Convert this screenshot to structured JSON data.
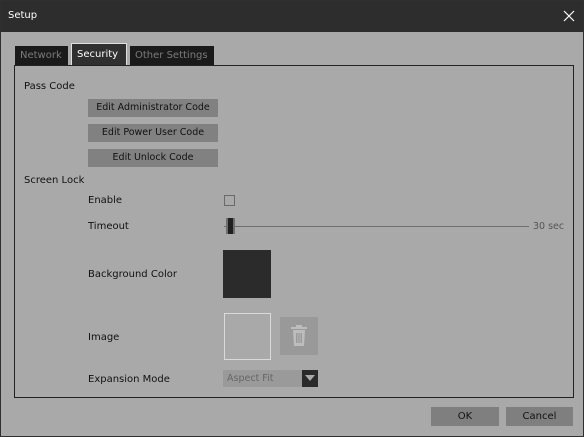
{
  "window": {
    "title": "Setup"
  },
  "tabs": [
    {
      "label": "Network",
      "active": false
    },
    {
      "label": "Security",
      "active": true
    },
    {
      "label": "Other Settings",
      "active": false
    }
  ],
  "pass_code": {
    "heading": "Pass Code",
    "buttons": [
      "Edit Administrator Code",
      "Edit Power User Code",
      "Edit Unlock Code"
    ]
  },
  "screen_lock": {
    "heading": "Screen Lock",
    "enable": {
      "label": "Enable",
      "checked": false
    },
    "timeout": {
      "label": "Timeout",
      "value_text": "30 sec",
      "level": 0.0
    },
    "background_color": {
      "label": "Background Color",
      "color": "#2b2b2b"
    },
    "image": {
      "label": "Image"
    },
    "expansion_mode": {
      "label": "Expansion Mode",
      "selected": "Aspect Fit"
    }
  },
  "footer": {
    "ok": "OK",
    "cancel": "Cancel"
  },
  "icons": {
    "close": "close-icon",
    "trash": "trash-icon",
    "dropdown": "chevron-down-icon"
  },
  "colors": {
    "titlebar": "#2d2d2d",
    "background": "#a9a9a9",
    "active_tab": "#303030"
  }
}
